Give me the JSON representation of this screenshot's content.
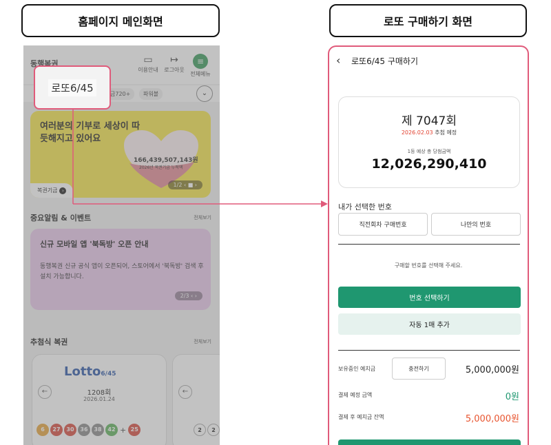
{
  "titles": {
    "left": "홈페이지 메인화면",
    "right": "로또 구매하기 화면"
  },
  "colors": {
    "green": "#1f9770",
    "red": "#e2402f",
    "highlight": "#e05a7a",
    "banner_yellow": "#f6e64a",
    "event_purple": "#e9c8ec"
  },
  "home": {
    "logo": "동행복권",
    "header_icons": [
      {
        "label": "이용안내",
        "icon": "book-icon"
      },
      {
        "label": "로그아웃",
        "icon": "logout-icon"
      },
      {
        "label": "전체메뉴",
        "icon": "menu-icon"
      }
    ],
    "tabs": [
      "금720+",
      "파워볼"
    ],
    "banner": {
      "title": "여러분의 기부로 세상이 따듯해지고 있어요",
      "amount": "166,439,507,143원",
      "amount_sub": "2026년 복권기금 누적액",
      "pager": "1/2 ‹ ■ ›",
      "fund_label": "복권기금"
    },
    "notice_section": {
      "title": "중요알림 & 이벤트",
      "more": "전체보기"
    },
    "event": {
      "title": "신규 모바일 앱 '북독방' 오픈 안내",
      "desc": "동행복권 신규 공식 앱이 오픈되어, 스토어에서 '북독방' 검색 후 설치 가능합니다.",
      "pager": "2/3 ‹ ›"
    },
    "draw_section": {
      "title": "추첨식 복권",
      "more": "전체보기"
    },
    "lotto_card": {
      "logo": "Lotto",
      "logo_suffix": "6/45",
      "round": "1208회",
      "date": "2026.01.24",
      "balls": [
        {
          "n": "6",
          "color": "#e8a53b"
        },
        {
          "n": "27",
          "color": "#d94b3f"
        },
        {
          "n": "30",
          "color": "#d94b3f"
        },
        {
          "n": "36",
          "color": "#8a8a8a"
        },
        {
          "n": "38",
          "color": "#8a8a8a"
        },
        {
          "n": "42",
          "color": "#5fb35c"
        }
      ],
      "bonus": {
        "n": "25",
        "color": "#d94b3f"
      }
    },
    "peek_card_balls": [
      "2",
      "2"
    ],
    "popout_label": "로또6/45"
  },
  "purchase": {
    "title": "로또6/45 구매하기",
    "round": "제 7047회",
    "draw_date": "2026.02.03",
    "draw_suffix": "추첨 예정",
    "prize_label": "1등 예상 총 당첨금액",
    "prize_amount": "12,026,290,410",
    "my_numbers_label": "내가 선택한 번호",
    "prev_button": "직전회차 구매번호",
    "mine_button": "나만의 번호",
    "hint": "구매할 번호를 선택해 주세요.",
    "select_button": "번호 선택하기",
    "auto_button": "자동 1매 추가",
    "deposit_label": "보유중인 예치금",
    "charge_button": "충전하기",
    "deposit_value": "5,000,000원",
    "pay_label": "결제 예정 금액",
    "pay_value": "0원",
    "after_label": "결제 후 예치금 잔액",
    "after_value": "5,000,000원"
  }
}
